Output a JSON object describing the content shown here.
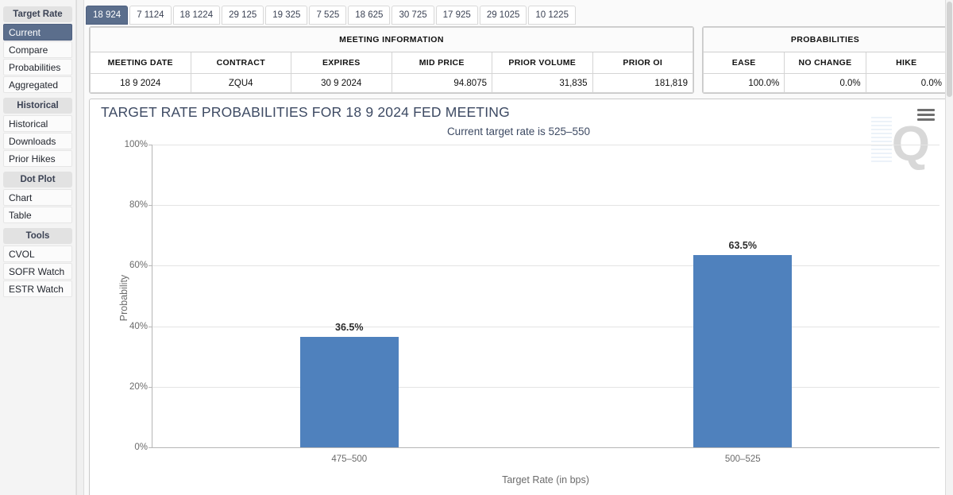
{
  "sidebar": {
    "groups": [
      {
        "header": "Target Rate",
        "items": [
          {
            "label": "Current",
            "active": true
          },
          {
            "label": "Compare",
            "active": false
          },
          {
            "label": "Probabilities",
            "active": false
          },
          {
            "label": "Aggregated",
            "active": false
          }
        ]
      },
      {
        "header": "Historical",
        "items": [
          {
            "label": "Historical",
            "active": false
          },
          {
            "label": "Downloads",
            "active": false
          },
          {
            "label": "Prior Hikes",
            "active": false
          }
        ]
      },
      {
        "header": "Dot Plot",
        "items": [
          {
            "label": "Chart",
            "active": false
          },
          {
            "label": "Table",
            "active": false
          }
        ]
      },
      {
        "header": "Tools",
        "items": [
          {
            "label": "CVOL",
            "active": false
          },
          {
            "label": "SOFR Watch",
            "active": false
          },
          {
            "label": "ESTR Watch",
            "active": false
          }
        ]
      }
    ]
  },
  "tabs": [
    {
      "label": "18 924",
      "active": true
    },
    {
      "label": "7 1124",
      "active": false
    },
    {
      "label": "18 1224",
      "active": false
    },
    {
      "label": "29 125",
      "active": false
    },
    {
      "label": "19 325",
      "active": false
    },
    {
      "label": "7 525",
      "active": false
    },
    {
      "label": "18 625",
      "active": false
    },
    {
      "label": "30 725",
      "active": false
    },
    {
      "label": "17 925",
      "active": false
    },
    {
      "label": "29 1025",
      "active": false
    },
    {
      "label": "10 1225",
      "active": false
    }
  ],
  "meeting_information": {
    "caption": "MEETING INFORMATION",
    "headers": [
      "MEETING DATE",
      "CONTRACT",
      "EXPIRES",
      "MID PRICE",
      "PRIOR VOLUME",
      "PRIOR OI"
    ],
    "row": {
      "meeting_date": "18 9 2024",
      "contract": "ZQU4",
      "expires": "30 9 2024",
      "mid_price": "94.8075",
      "prior_volume": "31,835",
      "prior_oi": "181,819"
    }
  },
  "probabilities": {
    "caption": "PROBABILITIES",
    "headers": [
      "EASE",
      "NO CHANGE",
      "HIKE"
    ],
    "row": {
      "ease": "100.0%",
      "no_change": "0.0%",
      "hike": "0.0%"
    }
  },
  "chart_header": {
    "title": "TARGET RATE PROBABILITIES FOR 18 9 2024 FED MEETING",
    "subtitle": "Current target rate is 525–550",
    "menu_icon": "hamburger-menu-icon",
    "watermark": "Q"
  },
  "colors": {
    "bar": "#4f81bd",
    "accent": "#5b6e8c",
    "title": "#3d4a63"
  },
  "chart_data": {
    "type": "bar",
    "title": "TARGET RATE PROBABILITIES FOR 18 9 2024 FED MEETING",
    "subtitle": "Current target rate is 525–550",
    "xlabel": "Target Rate (in bps)",
    "ylabel": "Probability",
    "categories": [
      "475–500",
      "500–525"
    ],
    "values": [
      36.5,
      63.5
    ],
    "value_labels": [
      "36.5%",
      "63.5%"
    ],
    "ylim": [
      0,
      100
    ],
    "yticks": [
      0,
      20,
      40,
      60,
      80,
      100
    ],
    "ytick_labels": [
      "0%",
      "20%",
      "40%",
      "60%",
      "80%",
      "100%"
    ],
    "grid": true,
    "legend": false,
    "bar_color": "#4f81bd"
  }
}
